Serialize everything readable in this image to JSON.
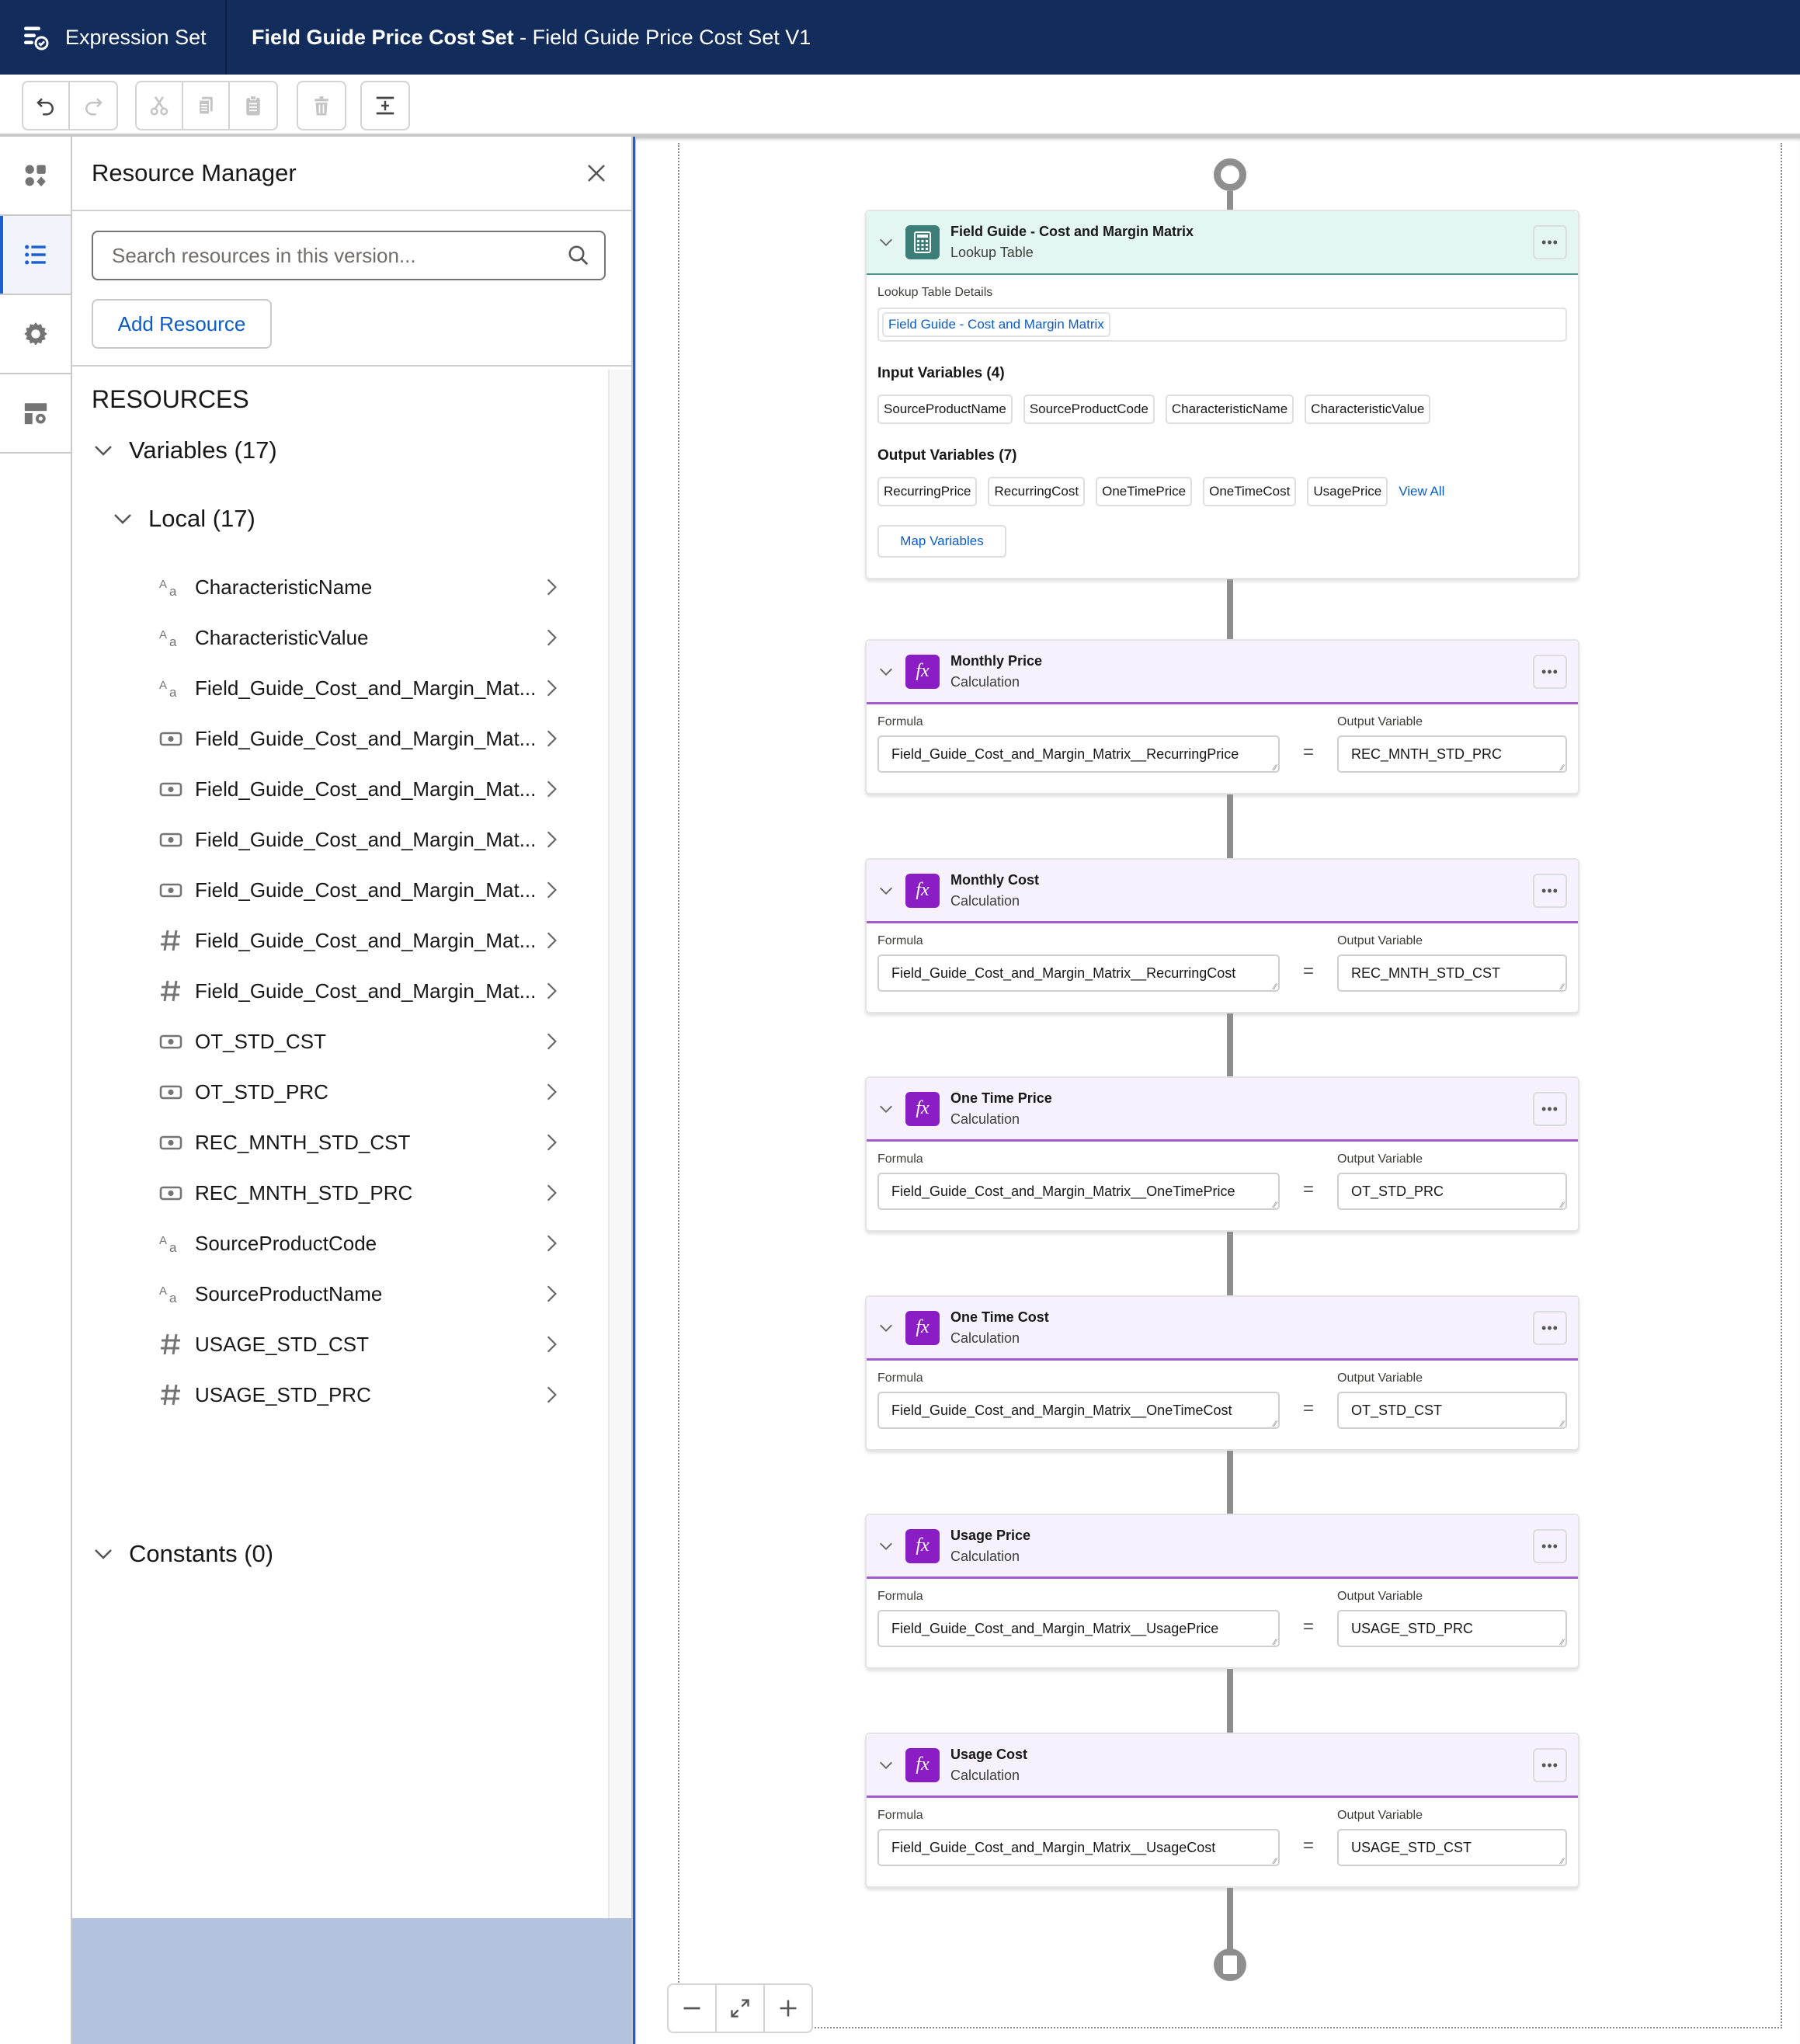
{
  "header": {
    "app_name": "Expression Set",
    "title_bold": "Field Guide Price Cost Set",
    "title_rest": " - Field Guide Price Cost Set V1"
  },
  "toolbar": {
    "buttons": [
      "undo",
      "redo",
      "cut",
      "copy",
      "paste",
      "delete",
      "auto-layout"
    ]
  },
  "rail": {
    "items": [
      {
        "name": "elements",
        "icon": "shapes-icon",
        "active": false
      },
      {
        "name": "resources",
        "icon": "list-icon",
        "active": true
      },
      {
        "name": "settings",
        "icon": "gear-icon",
        "active": false
      },
      {
        "name": "layout-settings",
        "icon": "layout-gear-icon",
        "active": false
      }
    ]
  },
  "panel": {
    "title": "Resource Manager",
    "search_placeholder": "Search resources in this version...",
    "add_resource": "Add Resource",
    "resources_heading": "RESOURCES",
    "variables_label": "Variables (17)",
    "local_label": "Local (17)",
    "constants_label": "Constants (0)",
    "variables": [
      {
        "type": "text",
        "name": "CharacteristicName"
      },
      {
        "type": "text",
        "name": "CharacteristicValue"
      },
      {
        "type": "text",
        "name": "Field_Guide_Cost_and_Margin_Mat..."
      },
      {
        "type": "currency",
        "name": "Field_Guide_Cost_and_Margin_Mat..."
      },
      {
        "type": "currency",
        "name": "Field_Guide_Cost_and_Margin_Mat..."
      },
      {
        "type": "currency",
        "name": "Field_Guide_Cost_and_Margin_Mat..."
      },
      {
        "type": "currency",
        "name": "Field_Guide_Cost_and_Margin_Mat..."
      },
      {
        "type": "number",
        "name": "Field_Guide_Cost_and_Margin_Mat..."
      },
      {
        "type": "number",
        "name": "Field_Guide_Cost_and_Margin_Mat..."
      },
      {
        "type": "currency",
        "name": "OT_STD_CST"
      },
      {
        "type": "currency",
        "name": "OT_STD_PRC"
      },
      {
        "type": "currency",
        "name": "REC_MNTH_STD_CST"
      },
      {
        "type": "currency",
        "name": "REC_MNTH_STD_PRC"
      },
      {
        "type": "text",
        "name": "SourceProductCode"
      },
      {
        "type": "text",
        "name": "SourceProductName"
      },
      {
        "type": "number",
        "name": "USAGE_STD_CST"
      },
      {
        "type": "number",
        "name": "USAGE_STD_PRC"
      }
    ]
  },
  "canvas": {
    "lookup": {
      "title": "Field Guide - Cost and Margin Matrix",
      "subtitle": "Lookup Table",
      "details_label": "Lookup Table Details",
      "details_value": "Field Guide - Cost and Margin Matrix",
      "input_title": "Input Variables (4)",
      "inputs": [
        "SourceProductName",
        "SourceProductCode",
        "CharacteristicName",
        "CharacteristicValue"
      ],
      "output_title": "Output Variables (7)",
      "outputs": [
        "RecurringPrice",
        "RecurringCost",
        "OneTimePrice",
        "OneTimeCost",
        "UsagePrice"
      ],
      "view_all": "View All",
      "map_variables": "Map Variables",
      "menu": "•••"
    },
    "formula_label": "Formula",
    "output_label": "Output Variable",
    "equals": "=",
    "calculations": [
      {
        "title": "Monthly Price",
        "subtitle": "Calculation",
        "formula": "Field_Guide_Cost_and_Margin_Matrix__RecurringPrice",
        "output": "REC_MNTH_STD_PRC"
      },
      {
        "title": "Monthly Cost",
        "subtitle": "Calculation",
        "formula": "Field_Guide_Cost_and_Margin_Matrix__RecurringCost",
        "output": "REC_MNTH_STD_CST"
      },
      {
        "title": "One Time Price",
        "subtitle": "Calculation",
        "formula": "Field_Guide_Cost_and_Margin_Matrix__OneTimePrice",
        "output": "OT_STD_PRC"
      },
      {
        "title": "One Time Cost",
        "subtitle": "Calculation",
        "formula": "Field_Guide_Cost_and_Margin_Matrix__OneTimeCost",
        "output": "OT_STD_CST"
      },
      {
        "title": "Usage Price",
        "subtitle": "Calculation",
        "formula": "Field_Guide_Cost_and_Margin_Matrix__UsagePrice",
        "output": "USAGE_STD_PRC"
      },
      {
        "title": "Usage Cost",
        "subtitle": "Calculation",
        "formula": "Field_Guide_Cost_and_Margin_Matrix__UsageCost",
        "output": "USAGE_STD_CST"
      }
    ],
    "calc_icon_text": "fx"
  },
  "zoom_controls": [
    "zoom-out",
    "fit-view",
    "zoom-in"
  ],
  "colors": {
    "header_bg": "#122c5c",
    "accent_blue": "#0b5cc7",
    "lookup_teal": "#3b7f78",
    "calc_purple": "#8a1ec4"
  }
}
